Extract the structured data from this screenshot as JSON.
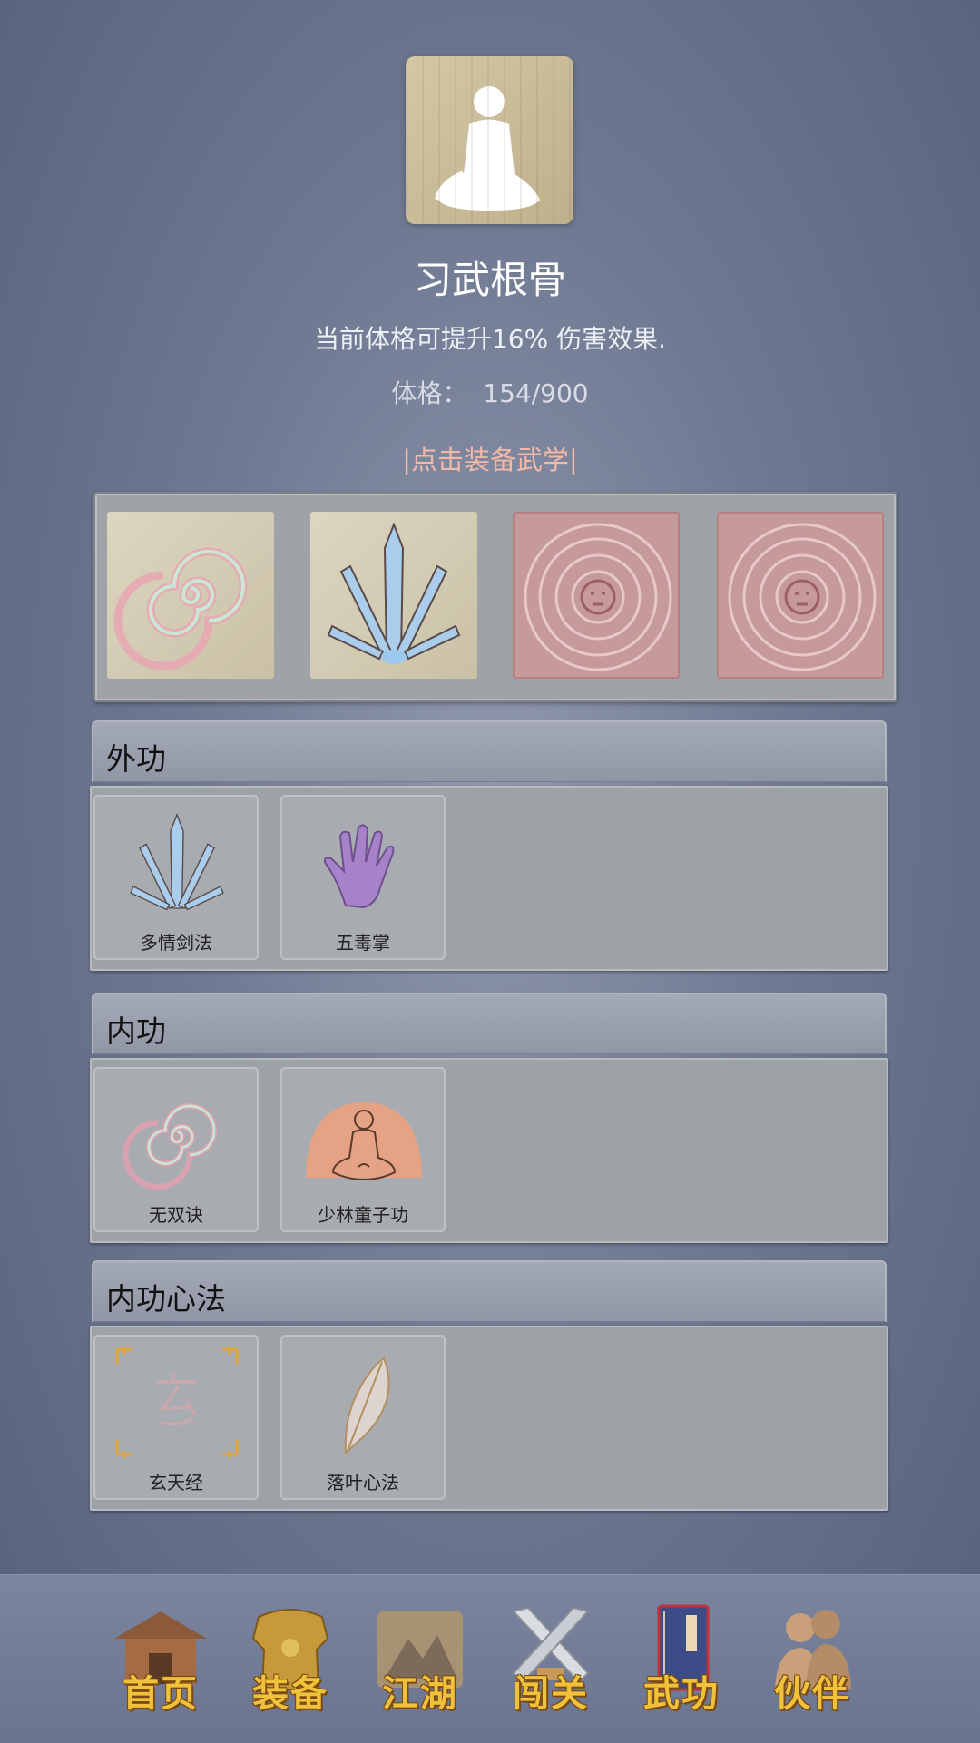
{
  "header": {
    "title": "习武根骨",
    "description": "当前体格可提升16% 伤害效果.",
    "constitution_label": "体格：",
    "constitution_value": "154/900",
    "equip_prompt": "|点击装备武学|"
  },
  "equipped_slots": [
    {
      "icon": "spiral-icon",
      "state": "equipped"
    },
    {
      "icon": "sword-fan-icon",
      "state": "equipped"
    },
    {
      "icon": "aztec-calendar-icon",
      "state": "locked"
    },
    {
      "icon": "aztec-calendar-icon",
      "state": "locked"
    }
  ],
  "sections": [
    {
      "title": "外功",
      "skills": [
        {
          "name": "多情剑法",
          "icon": "sword-fan-icon"
        },
        {
          "name": "五毒掌",
          "icon": "purple-hand-icon"
        }
      ]
    },
    {
      "title": "内功",
      "skills": [
        {
          "name": "无双诀",
          "icon": "spiral-icon"
        },
        {
          "name": "少林童子功",
          "icon": "meditating-monk-icon"
        }
      ]
    },
    {
      "title": "内功心法",
      "skills": [
        {
          "name": "玄天经",
          "icon": "xuan-glyph-icon"
        },
        {
          "name": "落叶心法",
          "icon": "leaf-icon"
        }
      ]
    }
  ],
  "nav": [
    {
      "label": "首页",
      "icon": "temple-icon"
    },
    {
      "label": "装备",
      "icon": "armor-icon"
    },
    {
      "label": "江湖",
      "icon": "scroll-mountain-icon"
    },
    {
      "label": "闯关",
      "icon": "crossed-swords-icon"
    },
    {
      "label": "武功",
      "icon": "manual-book-icon",
      "active": true
    },
    {
      "label": "伙伴",
      "icon": "companions-icon"
    }
  ],
  "colors": {
    "accent_link": "#f2b8a8",
    "nav_label": "#f0c13a",
    "locked_slot": "#c69a9b"
  }
}
